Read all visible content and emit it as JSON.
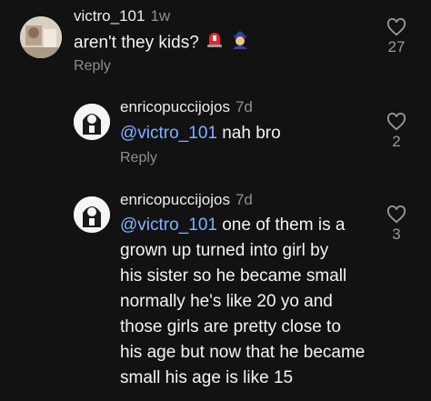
{
  "comments": [
    {
      "username": "victro_101",
      "time": "1w",
      "text": "aren't they kids?",
      "reply": "Reply",
      "likes": "27",
      "emojis": [
        "police-light-emoji",
        "police-officer-emoji"
      ]
    },
    {
      "username": "enricopuccijojos",
      "time": "7d",
      "mention": "@victro_101",
      "text": " nah bro",
      "reply": "Reply",
      "likes": "2"
    },
    {
      "username": "enricopuccijojos",
      "time": "7d",
      "lines": [
        " one of them is a",
        "grown up turned into girl by",
        "his sister so he became small",
        "normally he's  like 20 yo and",
        "those girls are pretty close to",
        "his age but now that he became",
        "small his age is like 15"
      ],
      "mention": "@victro_101",
      "likes": "3"
    }
  ],
  "colors": {
    "background": "#121212",
    "mention": "#7fb2ff",
    "muted": "#8e8e8e"
  }
}
